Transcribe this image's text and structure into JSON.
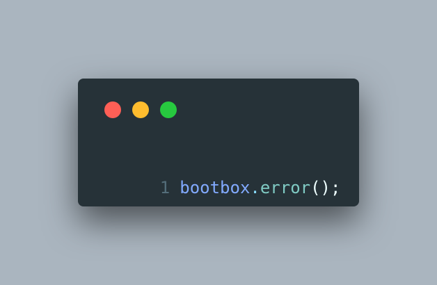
{
  "window": {
    "background": "#263238",
    "controls": [
      {
        "name": "close",
        "color": "#ff5f56"
      },
      {
        "name": "minimize",
        "color": "#ffbd2e"
      },
      {
        "name": "zoom",
        "color": "#27c93f"
      }
    ]
  },
  "code": {
    "line_number": "1",
    "tokens": {
      "object": "bootbox",
      "dot": ".",
      "method": "error",
      "args": "()",
      "terminator": ";"
    }
  }
}
